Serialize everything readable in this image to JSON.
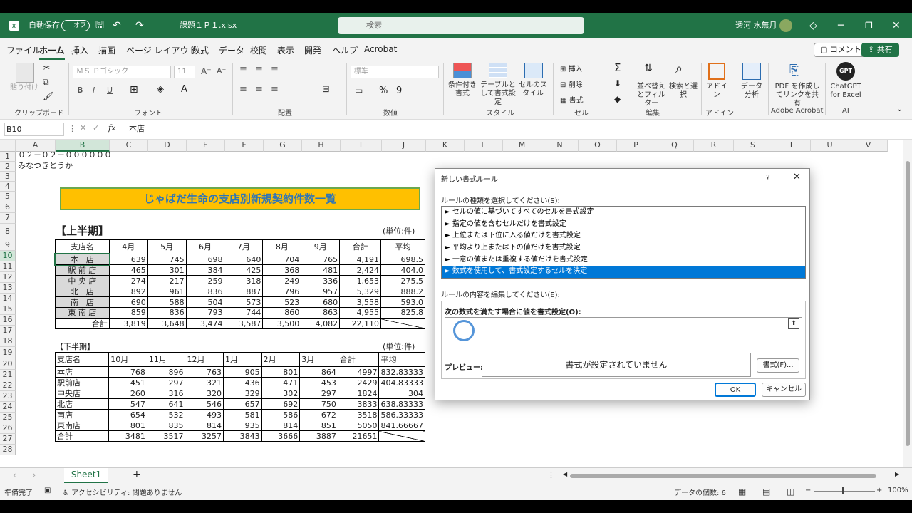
{
  "titlebar": {
    "autosave": "自動保存",
    "autosave_state": "オフ",
    "filename": "課題１Ｐ１.xlsx",
    "search_placeholder": "検索",
    "user": "透河 水無月"
  },
  "menu": {
    "tabs": [
      "ファイル",
      "ホーム",
      "挿入",
      "描画",
      "ページ レイアウト",
      "数式",
      "データ",
      "校閲",
      "表示",
      "開発",
      "ヘルプ",
      "Acrobat"
    ],
    "comment": "コメント",
    "share": "共有"
  },
  "ribbon": {
    "clipboard": {
      "paste": "貼り付け",
      "label": "クリップボード"
    },
    "font": {
      "name": "ＭＳ Ｐゴシック",
      "size": "11",
      "label": "フォント"
    },
    "align": {
      "label": "配置"
    },
    "number": {
      "format": "標準",
      "label": "数値"
    },
    "style": {
      "conditional": "条件付き書式",
      "table": "テーブルとして書式設定",
      "cell": "セルのスタイル",
      "label": "スタイル"
    },
    "cells": {
      "insert": "挿入",
      "delete": "削除",
      "format": "書式",
      "label": "セル"
    },
    "edit": {
      "sort": "並べ替えとフィルター",
      "find": "検索と選択",
      "label": "編集"
    },
    "addin": {
      "btn": "アドイン",
      "label": "アドイン"
    },
    "analysis": {
      "btn": "データ分析"
    },
    "acrobat": {
      "btn": "PDF を作成してリンクを共有",
      "label": "Adobe Acrobat"
    },
    "ai": {
      "btn": "ChatGPT for Excel",
      "label": "AI",
      "logo": "GPT"
    }
  },
  "formula": {
    "namebox": "B10",
    "fx": "fx",
    "value": "本店"
  },
  "columns": [
    "A",
    "B",
    "C",
    "D",
    "E",
    "F",
    "G",
    "H",
    "I",
    "J",
    "K",
    "L",
    "M",
    "N",
    "O",
    "P",
    "Q",
    "R",
    "S",
    "T",
    "U",
    "V"
  ],
  "rows": [
    "1",
    "2",
    "3",
    "4",
    "5",
    "6",
    "7",
    "8",
    "9",
    "10",
    "11",
    "12",
    "13",
    "14",
    "15",
    "16",
    "17",
    "18",
    "19",
    "20",
    "21",
    "22",
    "23",
    "24",
    "25",
    "26",
    "27",
    "28"
  ],
  "sheet": {
    "a1": "０２－０２－００００００",
    "a2": "みなつきとうか",
    "banner": "じゃばだ生命の支店別新規契約件数一覧",
    "h1_title": "【上半期】",
    "unit1": "(単位:件)",
    "h1_headers": [
      "支店名",
      "4月",
      "5月",
      "6月",
      "7月",
      "8月",
      "9月",
      "合計",
      "平均"
    ],
    "h1_rows": [
      [
        "本　店",
        "639",
        "745",
        "698",
        "640",
        "704",
        "765",
        "4,191",
        "698.5"
      ],
      [
        "駅 前 店",
        "465",
        "301",
        "384",
        "425",
        "368",
        "481",
        "2,424",
        "404.0"
      ],
      [
        "中 央 店",
        "274",
        "217",
        "259",
        "318",
        "249",
        "336",
        "1,653",
        "275.5"
      ],
      [
        "北　店",
        "892",
        "961",
        "836",
        "887",
        "796",
        "957",
        "5,329",
        "888.2"
      ],
      [
        "南　店",
        "690",
        "588",
        "504",
        "573",
        "523",
        "680",
        "3,558",
        "593.0"
      ],
      [
        "東 南 店",
        "859",
        "836",
        "793",
        "744",
        "860",
        "863",
        "4,955",
        "825.8"
      ]
    ],
    "h1_total": [
      "合計",
      "3,819",
      "3,648",
      "3,474",
      "3,587",
      "3,500",
      "4,082",
      "22,110",
      ""
    ],
    "h2_title": "【下半期】",
    "unit2": "(単位:件)",
    "h2_headers": [
      "支店名",
      "10月",
      "11月",
      "12月",
      "1月",
      "2月",
      "3月",
      "合計",
      "平均"
    ],
    "h2_rows": [
      [
        "本店",
        "768",
        "896",
        "763",
        "905",
        "801",
        "864",
        "4997",
        "832.83333"
      ],
      [
        "駅前店",
        "451",
        "297",
        "321",
        "436",
        "471",
        "453",
        "2429",
        "404.83333"
      ],
      [
        "中央店",
        "260",
        "316",
        "320",
        "329",
        "302",
        "297",
        "1824",
        "304"
      ],
      [
        "北店",
        "547",
        "641",
        "546",
        "657",
        "692",
        "750",
        "3833",
        "638.83333"
      ],
      [
        "南店",
        "654",
        "532",
        "493",
        "581",
        "586",
        "672",
        "3518",
        "586.33333"
      ],
      [
        "東南店",
        "801",
        "835",
        "814",
        "935",
        "814",
        "851",
        "5050",
        "841.66667"
      ]
    ],
    "h2_total": [
      "合計",
      "3481",
      "3517",
      "3257",
      "3843",
      "3666",
      "3887",
      "21651",
      ""
    ]
  },
  "dialog": {
    "title": "新しい書式ルール",
    "help": "?",
    "rule_type_label": "ルールの種類を選択してください(S):",
    "rules": [
      "► セルの値に基づいてすべてのセルを書式設定",
      "► 指定の値を含むセルだけを書式設定",
      "► 上位または下位に入る値だけを書式設定",
      "► 平均より上または下の値だけを書式設定",
      "► 一意の値または重複する値だけを書式設定",
      "► 数式を使用して、書式設定するセルを決定"
    ],
    "edit_label": "ルールの内容を編集してください(E):",
    "formula_label": "次の数式を満たす場合に値を書式設定(O):",
    "preview_label": "プレビュー:",
    "preview_text": "書式が設定されていません",
    "format_btn": "書式(F)...",
    "ok": "OK",
    "cancel": "キャンセル"
  },
  "sheettab": {
    "name": "Sheet1"
  },
  "status": {
    "ready": "準備完了",
    "accessibility": "アクセシビリティ: 問題ありません",
    "count": "データの個数: 6",
    "zoom": "100%"
  },
  "colors": {
    "excel_green": "#217346",
    "banner": "#ffc000",
    "selection": "#0078d7"
  }
}
